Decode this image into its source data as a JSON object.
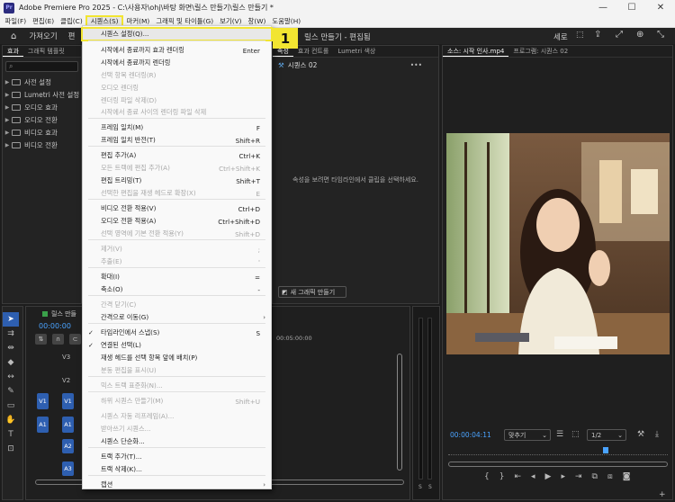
{
  "window": {
    "title": "Adobe Premiere Pro 2025 - C:\\사용자\\ohj\\바탕 화면\\릴스 만들기\\릴스 만들기 *",
    "logo": "Pr",
    "min_icon": "—",
    "max_icon": "☐",
    "close_icon": "✕"
  },
  "menubar": {
    "items": [
      "파일(F)",
      "편집(E)",
      "클립(C)",
      "시퀀스(S)",
      "마커(M)",
      "그래픽 및 타이틀(G)",
      "보기(V)",
      "창(W)",
      "도움말(H)"
    ]
  },
  "header": {
    "import": "가져오기",
    "edit_partial": "편",
    "project_title": "릴스 만들기 - 편집됨",
    "orientation": "세로"
  },
  "effects_panel": {
    "tabs": [
      "효과",
      "그래픽 템플릿"
    ],
    "items": [
      "사전 설정",
      "Lumetri 사전 설정",
      "오디오 효과",
      "오디오 전환",
      "비디오 효과",
      "비디오 전환"
    ]
  },
  "mid_panel": {
    "tabs": [
      "속성",
      "효과 컨트롤",
      "Lumetri 색상"
    ],
    "sequence_name": "시퀀스 02",
    "empty_message": "속성을 보려면 타임라인에서 클립을 선택하세요.",
    "new_graphic": "새 그래픽 만들기"
  },
  "monitor": {
    "tab_source": "소스: 시작 인사.mp4",
    "tab_program": "프로그램: 시퀀스 02",
    "timecode": "00:00:04:11",
    "fit": "맞추기",
    "resolution": "1/2"
  },
  "timeline": {
    "name_partial": "릴스 만들",
    "timecode": "00:00:00",
    "ruler_mark": "00:05:00:00",
    "tracks": [
      "V3",
      "V2",
      "V1",
      "A1",
      "A2",
      "A3"
    ],
    "src_labels": [
      "V1",
      "A1"
    ],
    "meter_labels": [
      "S",
      "S"
    ]
  },
  "callout": {
    "number": "1"
  },
  "sequence_menu": {
    "items": [
      {
        "label": "시퀀스 설정(Q)...",
        "shortcut": "",
        "disabled": false
      },
      {
        "label": "시작에서 종료까지 효과 렌더링",
        "shortcut": "Enter",
        "disabled": false
      },
      {
        "label": "시작에서 종료까지 렌더링",
        "shortcut": "",
        "disabled": false
      },
      {
        "label": "선택 항목 렌더링(R)",
        "shortcut": "",
        "disabled": true
      },
      {
        "label": "오디오 렌더링",
        "shortcut": "",
        "disabled": true
      },
      {
        "label": "렌더링 파일 삭제(D)",
        "shortcut": "",
        "disabled": true
      },
      {
        "label": "시작에서 종료 사이의 렌더링 파일 삭제",
        "shortcut": "",
        "disabled": true
      },
      {
        "label": "프레임 일치(M)",
        "shortcut": "F",
        "disabled": false
      },
      {
        "label": "프레임 일치 반전(T)",
        "shortcut": "Shift+R",
        "disabled": false
      },
      {
        "label": "편집 추가(A)",
        "shortcut": "Ctrl+K",
        "disabled": false
      },
      {
        "label": "모든 트랙에 편집 추가(A)",
        "shortcut": "Ctrl+Shift+K",
        "disabled": true
      },
      {
        "label": "편집 트리밍(T)",
        "shortcut": "Shift+T",
        "disabled": false
      },
      {
        "label": "선택한 편집을 재생 헤드로 확장(X)",
        "shortcut": "E",
        "disabled": true
      },
      {
        "label": "비디오 전환 적용(V)",
        "shortcut": "Ctrl+D",
        "disabled": false
      },
      {
        "label": "오디오 전환 적용(A)",
        "shortcut": "Ctrl+Shift+D",
        "disabled": false
      },
      {
        "label": "선택 영역에 기본 전환 적용(Y)",
        "shortcut": "Shift+D",
        "disabled": true
      },
      {
        "label": "제거(V)",
        "shortcut": ";",
        "disabled": true
      },
      {
        "label": "추출(E)",
        "shortcut": "'",
        "disabled": true
      },
      {
        "label": "확대(I)",
        "shortcut": "=",
        "disabled": false
      },
      {
        "label": "축소(O)",
        "shortcut": "-",
        "disabled": false
      },
      {
        "label": "간격 닫기(C)",
        "shortcut": "",
        "disabled": true
      },
      {
        "label": "간격으로 이동(G)",
        "shortcut": "",
        "disabled": false
      },
      {
        "label": "타임라인에서 스냅(S)",
        "shortcut": "S",
        "disabled": false
      },
      {
        "label": "연결된 선택(L)",
        "shortcut": "",
        "disabled": false
      },
      {
        "label": "재생 헤드를 선택 항목 앞에 배치(P)",
        "shortcut": "",
        "disabled": false
      },
      {
        "label": "분동 편집을 표시(U)",
        "shortcut": "",
        "disabled": true
      },
      {
        "label": "믹스 트랙 표준화(N)...",
        "shortcut": "",
        "disabled": true
      },
      {
        "label": "하위 시퀀스 만들기(M)",
        "shortcut": "Shift+U",
        "disabled": true
      },
      {
        "label": "시퀀스 자동 리프레임(A)...",
        "shortcut": "",
        "disabled": true
      },
      {
        "label": "받아쓰기 시퀀스...",
        "shortcut": "",
        "disabled": true
      },
      {
        "label": "시퀀스 단순화...",
        "shortcut": "",
        "disabled": false
      },
      {
        "label": "트랙 추가(T)...",
        "shortcut": "",
        "disabled": false
      },
      {
        "label": "트랙 삭제(K)...",
        "shortcut": "",
        "disabled": false
      },
      {
        "label": "캡션",
        "shortcut": "",
        "disabled": false
      }
    ],
    "check_mark": "✓",
    "submenu_arrow": "›"
  },
  "colors": {
    "highlight": "#f2e531",
    "track_blue": "#2e5fb0",
    "timecode_blue": "#4aa3ff"
  }
}
